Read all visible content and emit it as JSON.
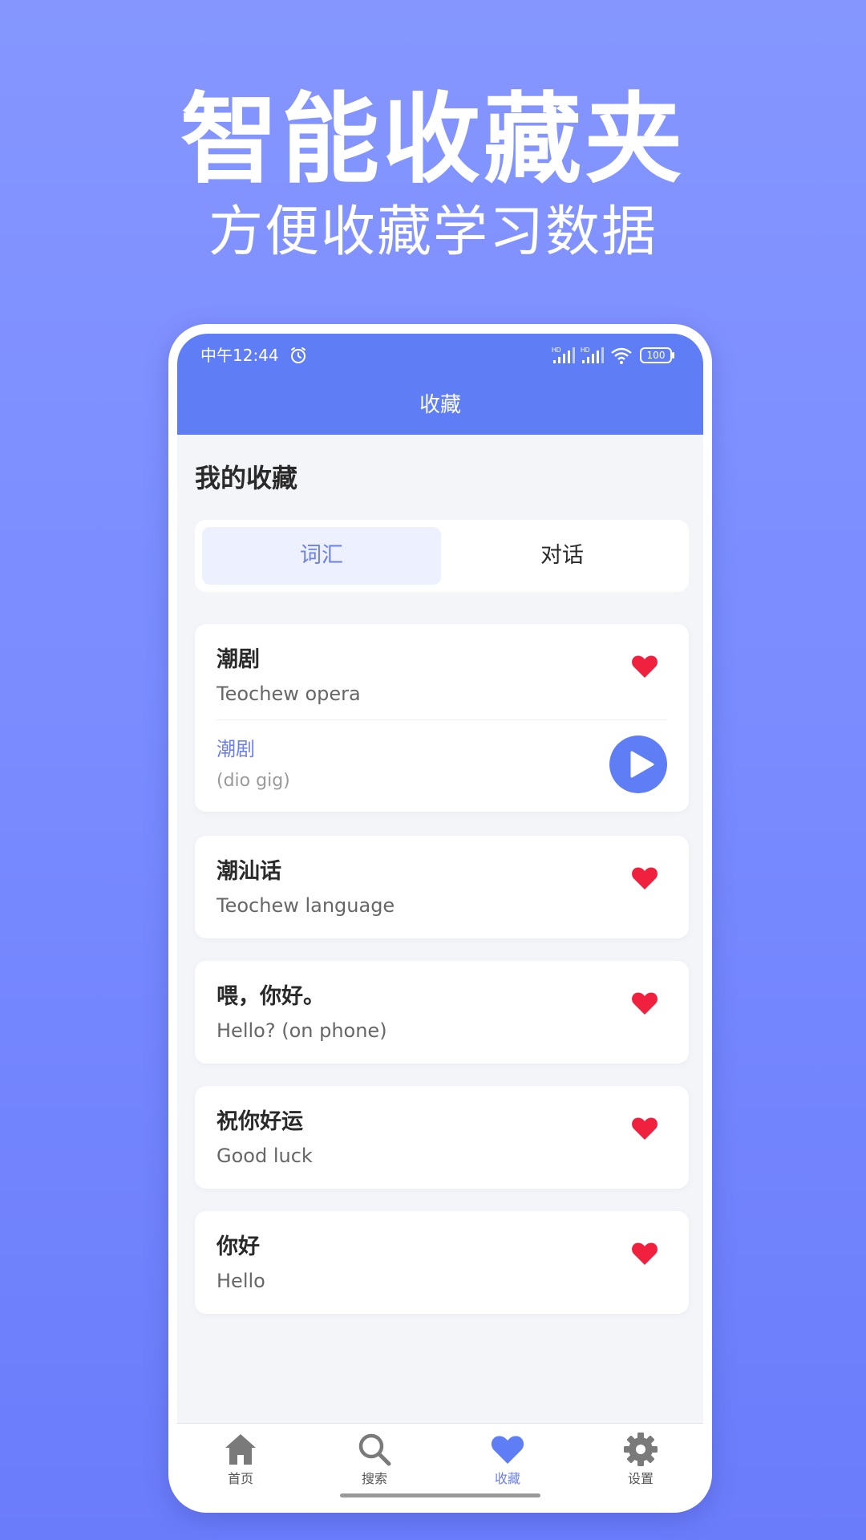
{
  "promo": {
    "title": "智能收藏夹",
    "subtitle": "方便收藏学习数据"
  },
  "status_bar": {
    "time": "中午12:44",
    "battery": "100",
    "signal_label": "HD"
  },
  "header": {
    "title": "收藏"
  },
  "section_title": "我的收藏",
  "tabs": [
    {
      "label": "词汇",
      "active": true
    },
    {
      "label": "对话",
      "active": false
    }
  ],
  "favorites": [
    {
      "word": "潮剧",
      "meaning": "Teochew opera",
      "favorited": true,
      "expanded": true,
      "dialect_word": "潮剧",
      "romanization": "(dio gig)"
    },
    {
      "word": "潮汕话",
      "meaning": "Teochew language",
      "favorited": true
    },
    {
      "word": "喂，你好。",
      "meaning": "Hello? (on phone)",
      "favorited": true
    },
    {
      "word": "祝你好运",
      "meaning": "Good luck",
      "favorited": true
    },
    {
      "word": "你好",
      "meaning": "Hello",
      "favorited": true
    }
  ],
  "bottom_nav": [
    {
      "label": "首页",
      "icon": "home-icon",
      "active": false
    },
    {
      "label": "搜索",
      "icon": "search-icon",
      "active": false
    },
    {
      "label": "收藏",
      "icon": "heart-icon",
      "active": true
    },
    {
      "label": "设置",
      "icon": "gear-icon",
      "active": false
    }
  ],
  "colors": {
    "accent": "#5f7ef5",
    "heart": "#f0213f",
    "tab_active_bg": "#edf0fe",
    "tab_active_text": "#6c80e6"
  }
}
